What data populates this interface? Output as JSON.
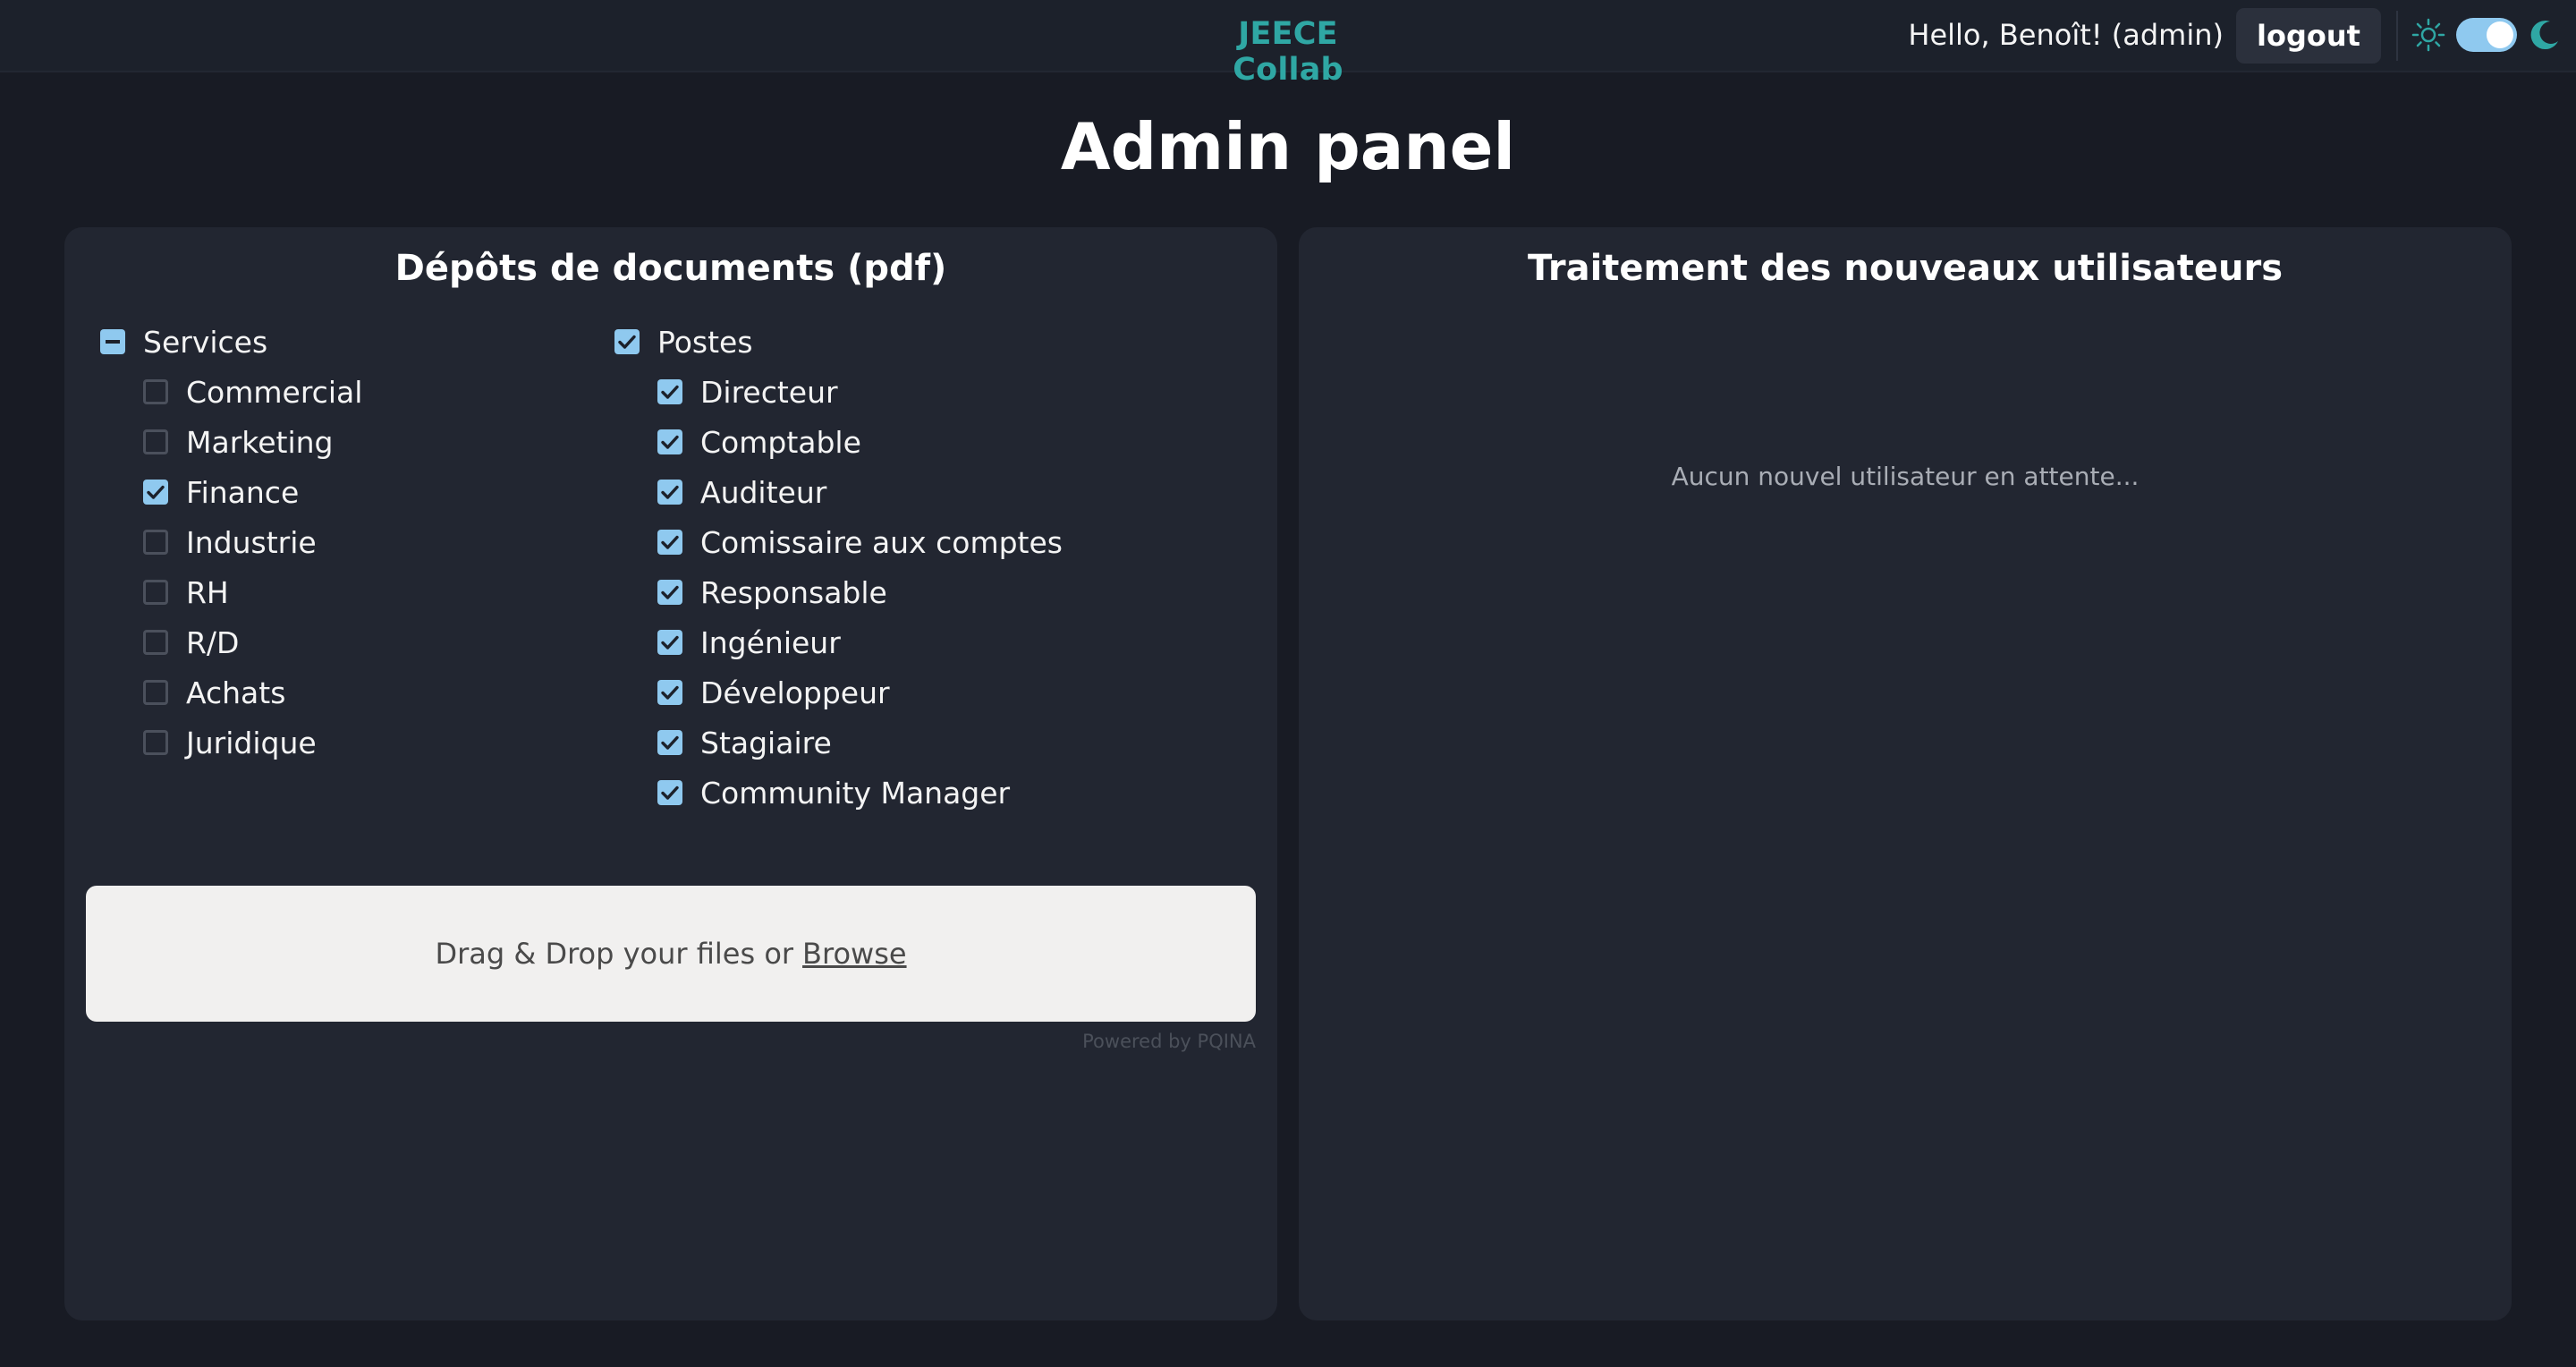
{
  "header": {
    "brand": "JEECE Collab",
    "greeting": "Hello, Benoît! (admin)",
    "logout_label": "logout",
    "theme_toggle": {
      "state": "dark",
      "sun_icon": "sun-icon",
      "moon_icon": "moon-icon"
    }
  },
  "page": {
    "title": "Admin panel"
  },
  "documents_panel": {
    "title": "Dépôts de documents (pdf)",
    "services": {
      "label": "Services",
      "state": "partial",
      "items": [
        {
          "label": "Commercial",
          "checked": false
        },
        {
          "label": "Marketing",
          "checked": false
        },
        {
          "label": "Finance",
          "checked": true
        },
        {
          "label": "Industrie",
          "checked": false
        },
        {
          "label": "RH",
          "checked": false
        },
        {
          "label": "R/D",
          "checked": false
        },
        {
          "label": "Achats",
          "checked": false
        },
        {
          "label": "Juridique",
          "checked": false
        }
      ]
    },
    "postes": {
      "label": "Postes",
      "state": "checked",
      "items": [
        {
          "label": "Directeur",
          "checked": true
        },
        {
          "label": "Comptable",
          "checked": true
        },
        {
          "label": "Auditeur",
          "checked": true
        },
        {
          "label": "Comissaire aux comptes",
          "checked": true
        },
        {
          "label": "Responsable",
          "checked": true
        },
        {
          "label": "Ingénieur",
          "checked": true
        },
        {
          "label": "Développeur",
          "checked": true
        },
        {
          "label": "Stagiaire",
          "checked": true
        },
        {
          "label": "Community Manager",
          "checked": true
        }
      ]
    },
    "dropzone": {
      "text": "Drag & Drop your files or",
      "browse_label": "Browse",
      "powered_by": "Powered by PQINA"
    }
  },
  "users_panel": {
    "title": "Traitement des nouveaux utilisateurs",
    "empty_message": "Aucun nouvel utilisateur en attente..."
  },
  "colors": {
    "background": "#181b24",
    "header": "#1c212b",
    "panel": "#222631",
    "brand": "#2fa7a4",
    "checkbox_accent": "#8fc9ef",
    "dropzone": "#f1f0ef"
  }
}
